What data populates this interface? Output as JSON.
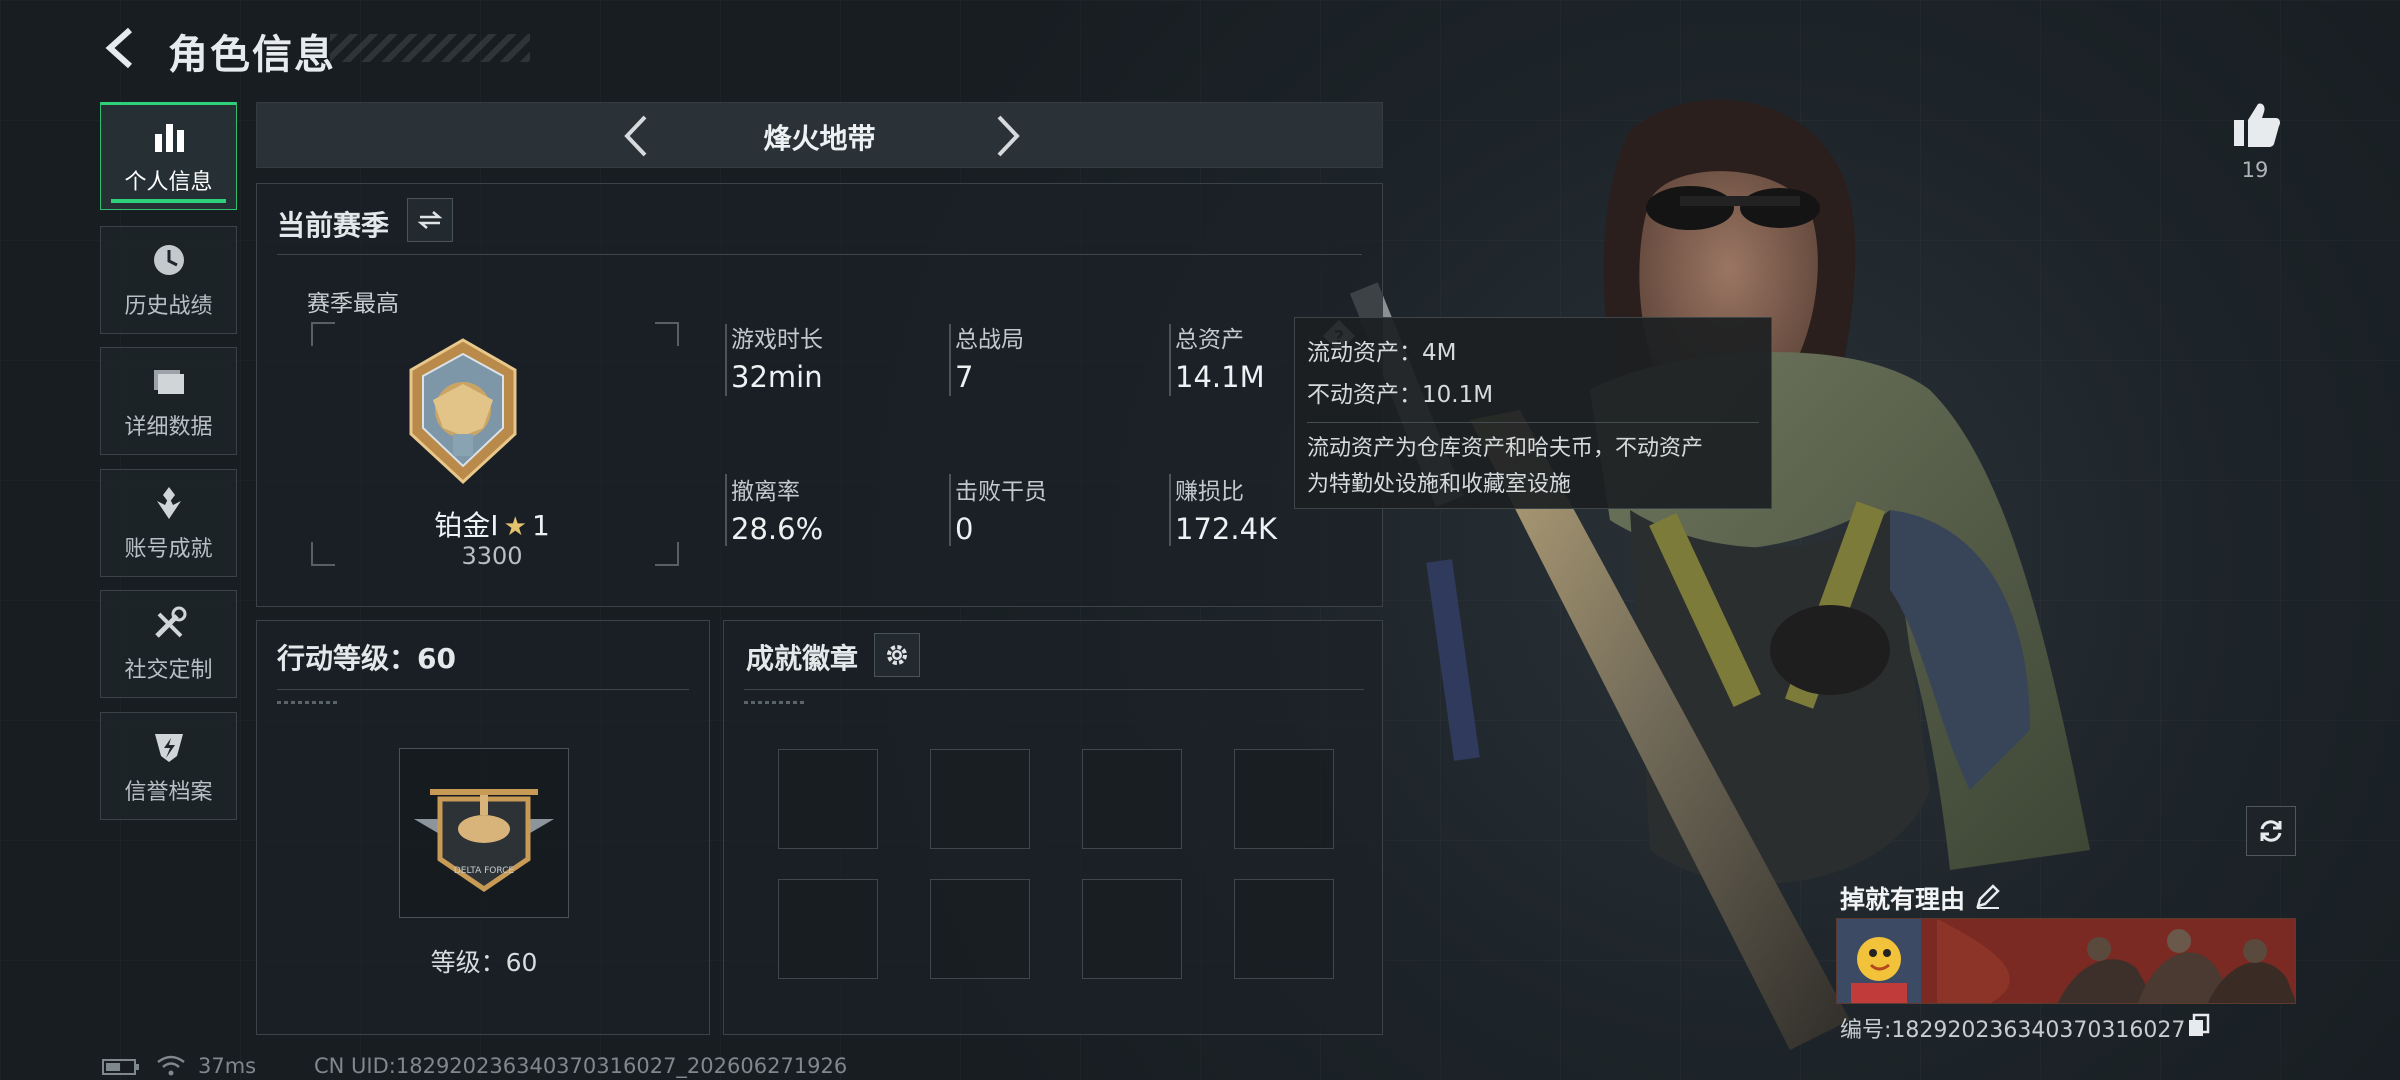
{
  "header": {
    "title": "角色信息",
    "back_icon": "chevron-left-icon"
  },
  "sidebar": {
    "items": [
      {
        "label": "个人信息",
        "icon": "bar-chart-icon",
        "active": true
      },
      {
        "label": "历史战绩",
        "icon": "clock-icon",
        "active": false
      },
      {
        "label": "详细数据",
        "icon": "folder-icon",
        "active": false
      },
      {
        "label": "账号成就",
        "icon": "medal-icon",
        "active": false
      },
      {
        "label": "社交定制",
        "icon": "tools-icon",
        "active": false
      },
      {
        "label": "信誉档案",
        "icon": "shield-lightning-icon",
        "active": false
      }
    ]
  },
  "mode_bar": {
    "title": "烽火地带"
  },
  "season": {
    "title": "当前赛季",
    "best_label": "赛季最高",
    "rank_name": "铂金I",
    "rank_stars": "1",
    "rank_points": "3300",
    "stats": [
      {
        "label": "游戏时长",
        "value": "32min"
      },
      {
        "label": "总战局",
        "value": "7"
      },
      {
        "label": "总资产",
        "value": "14.1M"
      },
      {
        "label": "撤离率",
        "value": "28.6%"
      },
      {
        "label": "击败干员",
        "value": "0"
      },
      {
        "label": "赚损比",
        "value": "172.4K"
      }
    ]
  },
  "tooltip": {
    "liquid": "流动资产：4M",
    "fixed": "不动资产：10.1M",
    "desc_line1": "流动资产为仓库资产和哈夫币，不动资产",
    "desc_line2": "为特勤处设施和收藏室设施"
  },
  "action_level": {
    "title": "行动等级：60",
    "level_text": "等级：60",
    "emblem_text": "DELTA FORCE"
  },
  "achievements": {
    "title": "成就徽章",
    "slots": 8
  },
  "profile": {
    "likes": "19",
    "card_name": "掉就有理由",
    "card_id": "编号:1829202363403703160​27"
  },
  "footer": {
    "ping": "37ms",
    "uid": "CN UID:18292023634037031602​7_202606271926"
  },
  "colors": {
    "accent": "#2fd07a",
    "panel_border": "#3a4348",
    "gold": "#c89a4e"
  }
}
